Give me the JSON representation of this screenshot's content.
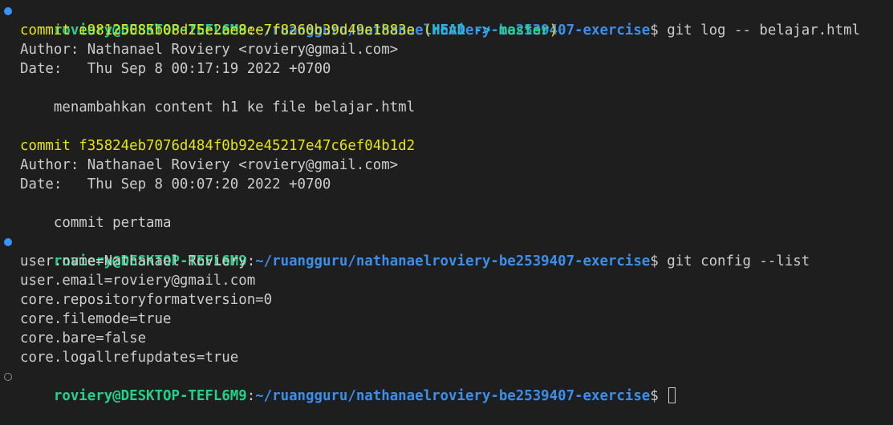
{
  "prompt": {
    "user_host": "roviery@DESKTOP-TEFL6M9",
    "separator": ":",
    "path": "~/ruangguru/nathanaelroviery-be2539407-exercise",
    "symbol": "$ "
  },
  "commands": {
    "first": "git log -- belajar.html",
    "second": "git config --list"
  },
  "log": {
    "commit1": {
      "prefix": "commit ",
      "hash": "e98125085b08d25e2ae8ee7f8260b39d49e1883e",
      "ref_open": " (",
      "head": "HEAD -> ",
      "branch": "master",
      "ref_close": ")",
      "author": "Author: Nathanael Roviery <roviery@gmail.com>",
      "date": "Date:   Thu Sep 8 00:17:19 2022 +0700",
      "message": "    menambahkan content h1 ke file belajar.html"
    },
    "commit2": {
      "prefix": "commit ",
      "hash": "f35824eb7076d484f0b92e45217e47c6ef04b1d2",
      "author": "Author: Nathanael Roviery <roviery@gmail.com>",
      "date": "Date:   Thu Sep 8 00:07:20 2022 +0700",
      "message": "    commit pertama"
    }
  },
  "config": {
    "lines": [
      "user.name=Nathanael Roviery",
      "user.email=roviery@gmail.com",
      "core.repositoryformatversion=0",
      "core.filemode=true",
      "core.bare=false",
      "core.logallrefupdates=true"
    ]
  },
  "colors": {
    "background": "#1e1e1e",
    "prompt_user": "#23d18b",
    "prompt_path": "#3b8eea",
    "commit": "#e5e510",
    "head": "#29b8db",
    "branch": "#23d18b",
    "decoration_success": "#3794ff",
    "decoration_default": "#8b8b8b"
  },
  "icons": {
    "command_success": "circle-filled-icon",
    "command_pending": "circle-outline-icon"
  }
}
